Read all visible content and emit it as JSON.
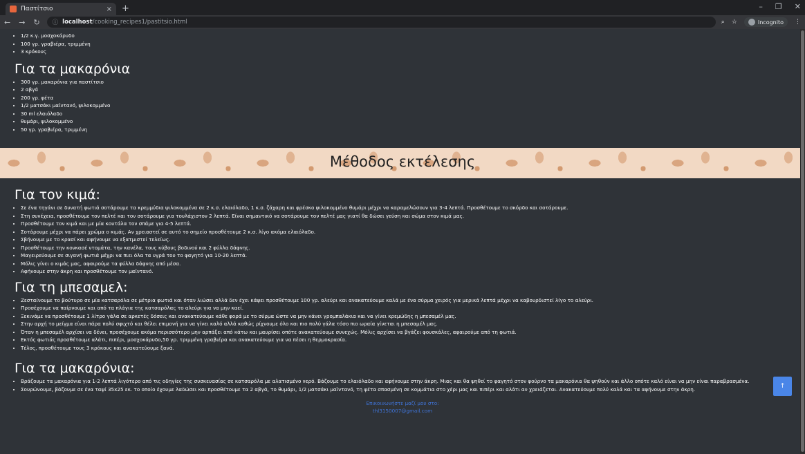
{
  "browser": {
    "tab_title": "Παστίτσιο",
    "tab_close": "×",
    "new_tab": "+",
    "url_host": "localhost",
    "url_path": "/cooking_recipes1/pastitsio.html",
    "incognito": "Incognito",
    "controls": {
      "minimize": "–",
      "restore": "❐",
      "close": "✕"
    }
  },
  "ingredients": {
    "top_items": [
      "1/2 κ.γ. μοσχοκάρυδο",
      "100 γρ. γραβιέρα, τριμμένη",
      "3 κρόκους"
    ],
    "pasta_heading": "Για τα μακαρόνια",
    "pasta_items": [
      "300 γρ. μακαρόνια για παστίτσιο",
      "2 αβγά",
      "200 γρ. φέτα",
      "1/2 ματσάκι μαϊντανό, ψιλοκομμένο",
      "30 ml ελαιόλαδο",
      "θυμάρι, ψιλοκομμένο",
      "50 γρ. γραβιέρα, τριμμένη"
    ]
  },
  "method": {
    "title": "Μέθοδος εκτέλεσης",
    "mince_heading": "Για τον κιμά:",
    "mince_steps": [
      "Σε ένα τηγάνι σε δυνατή φωτιά σοτάρουμε τα κρεμμύδια ψιλοκομμένα σε 2 κ.σ. ελαιόλαδο, 1 κ.σ. ζάχαρη και φρέσκο ψιλοκομμένο θυμάρι μέχρι να καραμελώσουν για 3-4 λεπτά. Προσθέτουμε το σκόρδο και σοτάρουμε.",
      "Στη συνέχεια, προσθέτουμε τον πελτέ και τον σοτάρουμε για τουλάχιστον 2 λεπτά. Είναι σημαντικό να σοτάρουμε τον πελτέ μας γιατί θα δώσει γεύση και σώμα στον κιμά μας.",
      "Προσθέτουμε τον κιμά και με μία κουτάλα τον σπάμε για 4-5 λεπτά.",
      "Σοτάρουμε μέχρι να πάρει χρώμα ο κιμάς. Αν χρειαστεί σε αυτό το σημείο προσθέτουμε 2 κ.σ. λίγο ακόμα ελαιόλαδο.",
      "Σβήνουμε με το κρασί και αφήνουμε να εξατμιστεί τελείως.",
      "Προσθέτουμε την κονκασέ ντομάτα, την κανέλα, τους κύβους βοδινού και 2 φύλλα δάφνης.",
      "Μαγειρεύουμε σε σιγανή φωτιά μέχρι να πιει όλα τα υγρά του το φαγητό για 10-20 λεπτά.",
      "Μόλις γίνει ο κιμάς μας, αφαιρούμε τα φύλλα δάφνης από μέσα.",
      "Αφήνουμε στην άκρη και προσθέτουμε τον μαϊντανό."
    ],
    "bechamel_heading": "Για τη μπεσαμελ:",
    "bechamel_steps": [
      "Ζεσταίνουμε το βούτυρο σε μία κατσαρόλα σε μέτρια φωτιά και όταν λιώσει αλλά δεν έχει κάψει προσθέτουμε 100 γρ. αλεύρι και ανακατεύουμε καλά με ένα σύρμα χειρός για μερικά λεπτά μέχρι να καβουρδιστεί λίγο το αλεύρι.",
      "Προσέχουμε να παίρνουμε και από τα πλάγια της κατσαρόλας το αλεύρι για να μην καεί.",
      "Ξεκινάμε να προσθέτουμε 1 λίτρο γάλα σε αρκετές δόσεις και ανακατεύουμε κάθε φορά με το σύρμα ώστε να μην κάνει γρομπαλάκια και να γίνει κρεμώδης η μπεσαμέλ μας.",
      "Στην αρχή το μείγμα είναι πάρα πολύ σφιχτό και θέλει επιμονή για να γίνει καλό αλλά καθώς ρίχνουμε όλο και πιο πολύ γάλα τόσο πιο ωραία γίνεται η μπεσαμέλ μας.",
      "Όταν η μπεσαμέλ αρχίσει να δένει, προσέχουμε ακόμα περισσότερο μην αρπάξει από κάτω και μαυρίσει οπότε ανακατεύουμε συνεχώς. Μόλις αρχίσει να βγάζει φουσκάλες, αφαιρούμε από τη φωτιά.",
      "Εκτός φωτιάς προσθέτουμε αλάτι, πιπέρι, μοσχοκάρυδο,50 γρ. τριμμένη γραβιέρα και ανακατεύουμε για να πέσει η θερμοκρασία.",
      "Τέλος, προσθέτουμε τους 3 κρόκους και ανακατεύουμε ξανά."
    ],
    "pasta_heading": "Για τα μακαρόνια:",
    "pasta_steps": [
      "Βράζουμε τα μακαρόνια για 1-2 λεπτά λιγότερο από τις οδηγίες της συσκευασίας σε κατσαρόλα με αλατισμένο νερό. Βάζουμε το ελαιόλαδο και αφήνουμε στην άκρη. Μιας και θα ψηθεί το φαγητό στον φούρνο τα μακαρόνια θα ψηθούν και άλλο οπότε καλό είναι να μην είναι παραβρασμένα.",
      "Σουρώνουμε, βάζουμε σε ένα ταψί 35x25 εκ. το οποίο έχουμε λαδώσει και προσθέτουμε τα 2 αβγά, το θυμάρι, 1/2 ματσάκι μαϊντανό, τη φέτα σπασμένη σε κομμάτια στο χέρι μας και πιπέρι και αλάτι αν χρειάζεται. Ανακατεύουμε πολύ καλά και τα αφήνουμε στην άκρη."
    ]
  },
  "footer": {
    "contact": "Επικοινωνήστε μαζί μου στο:",
    "email": "thl3150007@gmail.com"
  },
  "back_to_top": "↑"
}
